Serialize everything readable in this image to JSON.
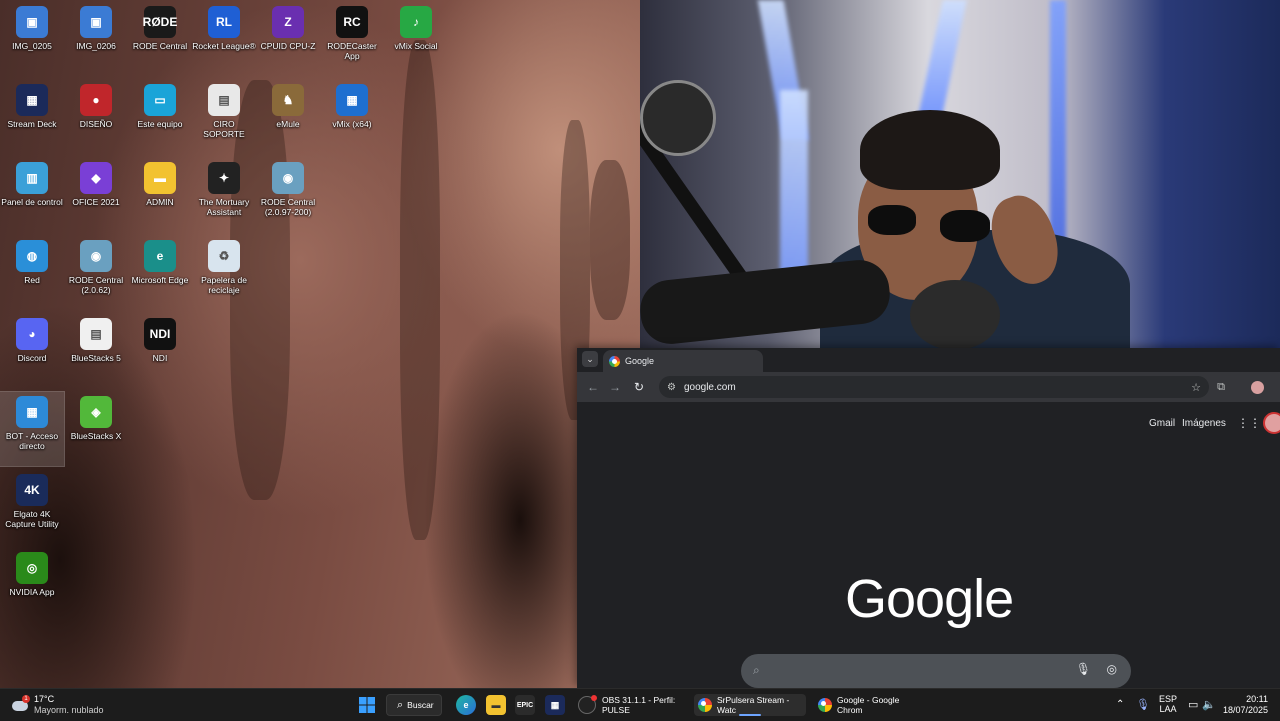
{
  "desktop": {
    "icons": [
      {
        "label": "IMG_0205",
        "glyph": "▣",
        "color": "#3b7bd4"
      },
      {
        "label": "IMG_0206",
        "glyph": "▣",
        "color": "#3b7bd4"
      },
      {
        "label": "RODE Central",
        "glyph": "RØDE",
        "color": "#1a1a1a"
      },
      {
        "label": "Rocket League®",
        "glyph": "RL",
        "color": "#1f5fd4"
      },
      {
        "label": "CPUID CPU-Z",
        "glyph": "Z",
        "color": "#6a2fb0"
      },
      {
        "label": "RODECaster App",
        "glyph": "RC",
        "color": "#111111"
      },
      {
        "label": "vMix Social",
        "glyph": "♪",
        "color": "#27a844"
      },
      {
        "label": "Stream Deck",
        "glyph": "▦",
        "color": "#1b2a5a"
      },
      {
        "label": "DISEÑO",
        "glyph": "●",
        "color": "#c0262b"
      },
      {
        "label": "Este equipo",
        "glyph": "▭",
        "color": "#1aa4d8"
      },
      {
        "label": "CIRO SOPORTE",
        "glyph": "▤",
        "color": "#e8e8e8"
      },
      {
        "label": "eMule",
        "glyph": "♞",
        "color": "#8a6a3a"
      },
      {
        "label": "vMix (x64)",
        "glyph": "▦",
        "color": "#1e6fd0"
      },
      {
        "label": "Panel de control",
        "glyph": "▥",
        "color": "#3ba0d8"
      },
      {
        "label": "OFICE 2021",
        "glyph": "◆",
        "color": "#7a3fd6"
      },
      {
        "label": "ADMIN",
        "glyph": "▬",
        "color": "#f2c230"
      },
      {
        "label": "The Mortuary Assistant",
        "glyph": "✦",
        "color": "#222222"
      },
      {
        "label": "RODE Central (2.0.97-200)",
        "glyph": "◉",
        "color": "#6aa0c0"
      },
      {
        "label": "Red",
        "glyph": "◍",
        "color": "#2a8fd8"
      },
      {
        "label": "RODE Central (2.0.62)",
        "glyph": "◉",
        "color": "#6aa0c0"
      },
      {
        "label": "Microsoft Edge",
        "glyph": "e",
        "color": "#1a8f8a"
      },
      {
        "label": "Papelera de reciclaje",
        "glyph": "♻",
        "color": "#d8e4ee"
      },
      {
        "label": "Discord",
        "glyph": "◕",
        "color": "#5865f2"
      },
      {
        "label": "BlueStacks 5",
        "glyph": "▤",
        "color": "#f0f0f0"
      },
      {
        "label": "NDI",
        "glyph": "NDI",
        "color": "#111111"
      },
      {
        "label": "BOT - Acceso directo",
        "glyph": "▦",
        "color": "#2d8ad8"
      },
      {
        "label": "BlueStacks X",
        "glyph": "◈",
        "color": "#52b83a"
      },
      {
        "label": "Elgato 4K Capture Utility",
        "glyph": "4K",
        "color": "#1a2b5a"
      },
      {
        "label": "NVIDIA App",
        "glyph": "◎",
        "color": "#2a8a1a"
      }
    ]
  },
  "chrome": {
    "tab_title": "Google",
    "url": "google.com",
    "top_links": {
      "gmail": "Gmail",
      "images": "Imágenes"
    },
    "logo": "Google"
  },
  "taskbar": {
    "weather_temp": "17°C",
    "weather_desc": "Mayorm. nublado",
    "search_label": "Buscar",
    "windows": [
      {
        "label": "OBS 31.1.1 - Perfil: PULSE"
      },
      {
        "label": "SrPulsera Stream - Watc"
      },
      {
        "label": "Google - Google Chrom"
      }
    ],
    "lang_top": "ESP",
    "lang_bottom": "LAA",
    "time": "20:11",
    "date": "18/07/2025"
  }
}
